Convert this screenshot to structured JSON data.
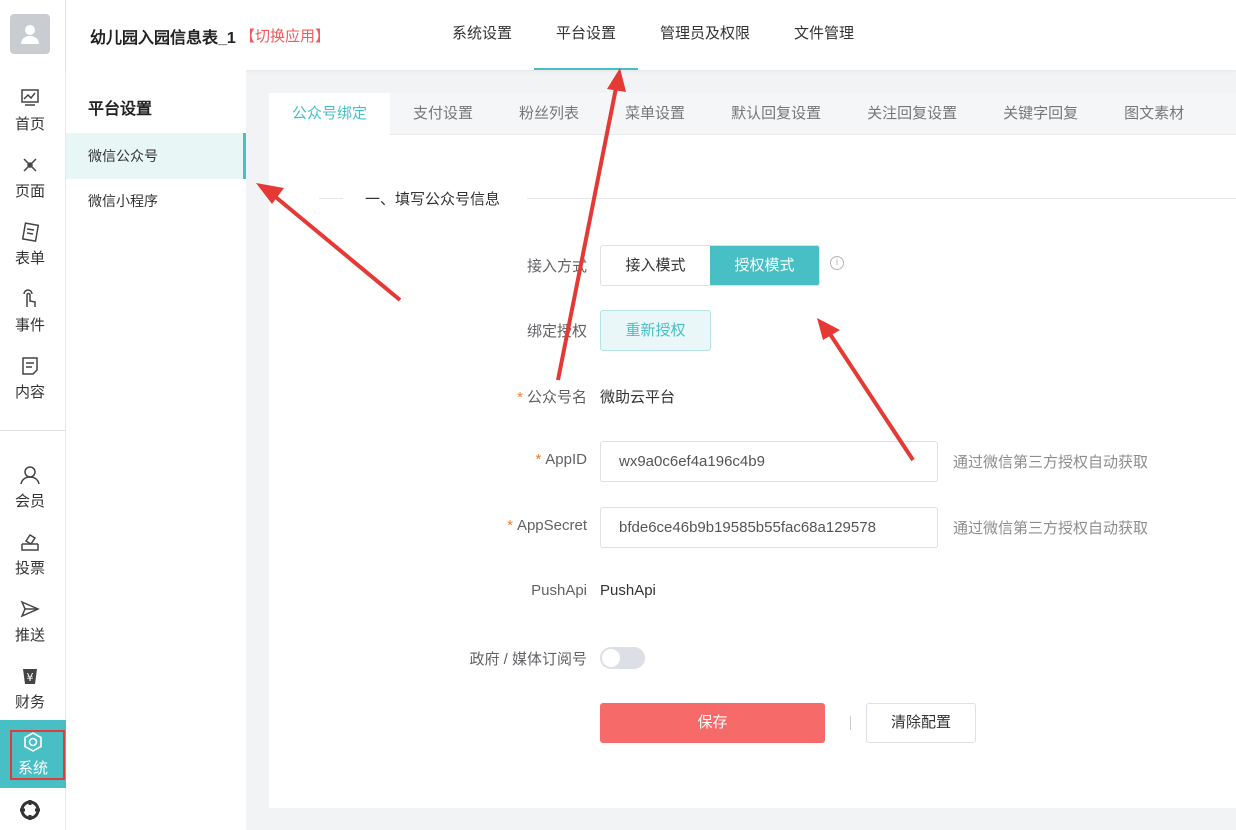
{
  "app": {
    "title": "幼儿园入园信息表_1",
    "switch_label": "【切换应用】"
  },
  "rail": {
    "items": [
      {
        "label": "首页",
        "icon": "chart-icon"
      },
      {
        "label": "页面",
        "icon": "design-icon"
      },
      {
        "label": "表单",
        "icon": "form-icon"
      },
      {
        "label": "事件",
        "icon": "touch-icon"
      },
      {
        "label": "内容",
        "icon": "document-icon"
      },
      {
        "label": "会员",
        "icon": "user-icon"
      },
      {
        "label": "投票",
        "icon": "vote-icon"
      },
      {
        "label": "推送",
        "icon": "send-icon"
      },
      {
        "label": "财务",
        "icon": "yen-icon"
      },
      {
        "label": "系统",
        "icon": "settings-icon"
      }
    ],
    "active": "系统"
  },
  "top_nav": {
    "items": [
      "系统设置",
      "平台设置",
      "管理员及权限",
      "文件管理"
    ],
    "active": "平台设置"
  },
  "sidebar": {
    "title": "平台设置",
    "items": [
      "微信公众号",
      "微信小程序"
    ],
    "active": "微信公众号"
  },
  "tabs": {
    "items": [
      "公众号绑定",
      "支付设置",
      "粉丝列表",
      "菜单设置",
      "默认回复设置",
      "关注回复设置",
      "关键字回复",
      "图文素材"
    ],
    "active": "公众号绑定"
  },
  "form": {
    "section_title": "一、填写公众号信息",
    "access_mode_label": "接入方式",
    "access_modes": [
      "接入模式",
      "授权模式"
    ],
    "access_mode_selected": "授权模式",
    "bind_label": "绑定授权",
    "reauth_button": "重新授权",
    "name_label": "公众号名",
    "name_value": "微助云平台",
    "appid_label": "AppID",
    "appid_value": "wx9a0c6ef4a196c4b9",
    "appsecret_label": "AppSecret",
    "appsecret_value": "bfde6ce46b9b19585b55fac68a129578",
    "auto_hint": "通过微信第三方授权自动获取",
    "pushapi_label": "PushApi",
    "pushapi_value": "PushApi",
    "gov_label": "政府 / 媒体订阅号",
    "gov_enabled": false,
    "required_mark": "*",
    "save_button": "保存",
    "clear_button": "清除配置"
  },
  "colors": {
    "accent": "#47bfc4",
    "danger": "#f66a69",
    "annotation": "#e53935"
  }
}
